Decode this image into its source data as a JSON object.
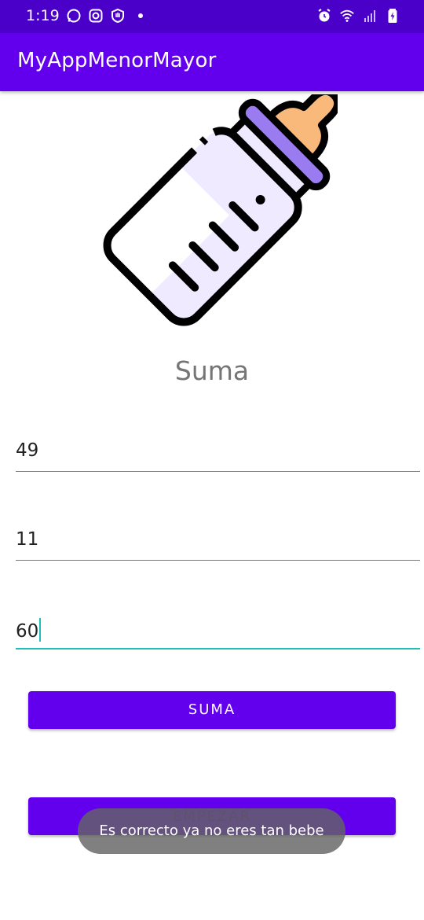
{
  "status_bar": {
    "time": "1:19",
    "left_icons": [
      "whatsapp-icon",
      "instagram-icon",
      "vpn-hand-icon",
      "more-dot-icon"
    ],
    "right_icons": [
      "alarm-icon",
      "wifi-icon",
      "signal-icon",
      "battery-charging-icon"
    ]
  },
  "app_bar": {
    "title": "MyAppMenorMayor"
  },
  "main": {
    "image_icon": "baby-bottle-icon",
    "heading": "Suma",
    "fields": [
      {
        "value": "49"
      },
      {
        "value": "11"
      },
      {
        "value": "60",
        "focused": true
      }
    ],
    "sum_button": "SUMA",
    "start_button": "EMPEZAR"
  },
  "toast": {
    "message": "Es correcto ya no eres tan bebe"
  },
  "colors": {
    "primary": "#6200ee",
    "primary_dark": "#4b00c9",
    "accent": "#1fbfb8",
    "bottle_purple": "#9b7bf0",
    "bottle_body": "#efeaff",
    "nipple": "#f9b97b"
  }
}
